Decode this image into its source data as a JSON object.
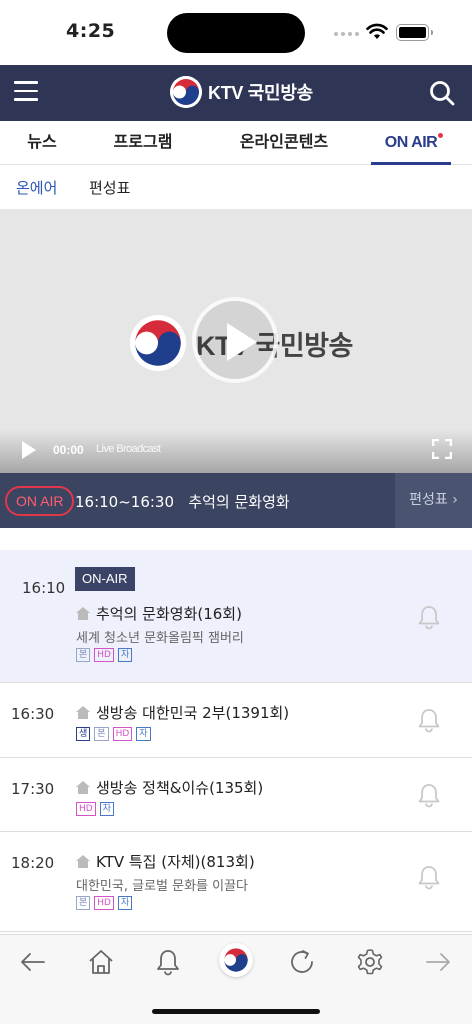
{
  "status": {
    "time": "4:25"
  },
  "header": {
    "brand": "KTV 국민방송"
  },
  "tabs": [
    {
      "label": "뉴스",
      "active": false
    },
    {
      "label": "프로그램",
      "active": false
    },
    {
      "label": "온라인콘텐츠",
      "active": false
    },
    {
      "label": "ON AIR",
      "active": true
    }
  ],
  "subtabs": [
    {
      "label": "온에어",
      "active": true
    },
    {
      "label": "편성표",
      "active": false
    }
  ],
  "player": {
    "logo_text": "KTV 국민방송",
    "time": "00:00",
    "live_label": "Live Broadcast"
  },
  "now": {
    "badge": "ON AIR",
    "text": "16:10~16:30   추억의 문화영화",
    "schedule_button": "편성표"
  },
  "schedule": [
    {
      "time": "16:10",
      "onair_badge": "ON-AIR",
      "title": "추억의 문화영화(16회)",
      "subtitle": "세계 청소년 문화올림픽 잼버리",
      "tags": [
        "본",
        "HD",
        "자"
      ],
      "current": true
    },
    {
      "time": "16:30",
      "title": "생방송 대한민국 2부(1391회)",
      "subtitle": "",
      "tags": [
        "생",
        "본",
        "HD",
        "자"
      ],
      "current": false
    },
    {
      "time": "17:30",
      "title": "생방송 정책&이슈(135회)",
      "subtitle": "",
      "tags": [
        "HD",
        "자"
      ],
      "current": false
    },
    {
      "time": "18:20",
      "title": "KTV 특집 (자체)(813회)",
      "subtitle": "대한민국, 글로벌 문화를 이끌다",
      "tags": [
        "본",
        "HD",
        "자"
      ],
      "current": false
    }
  ],
  "colors": {
    "header": "#2f3554",
    "accent": "#2a3d8c",
    "onair_red": "#e2364a",
    "nowbar": "#3b4460"
  }
}
